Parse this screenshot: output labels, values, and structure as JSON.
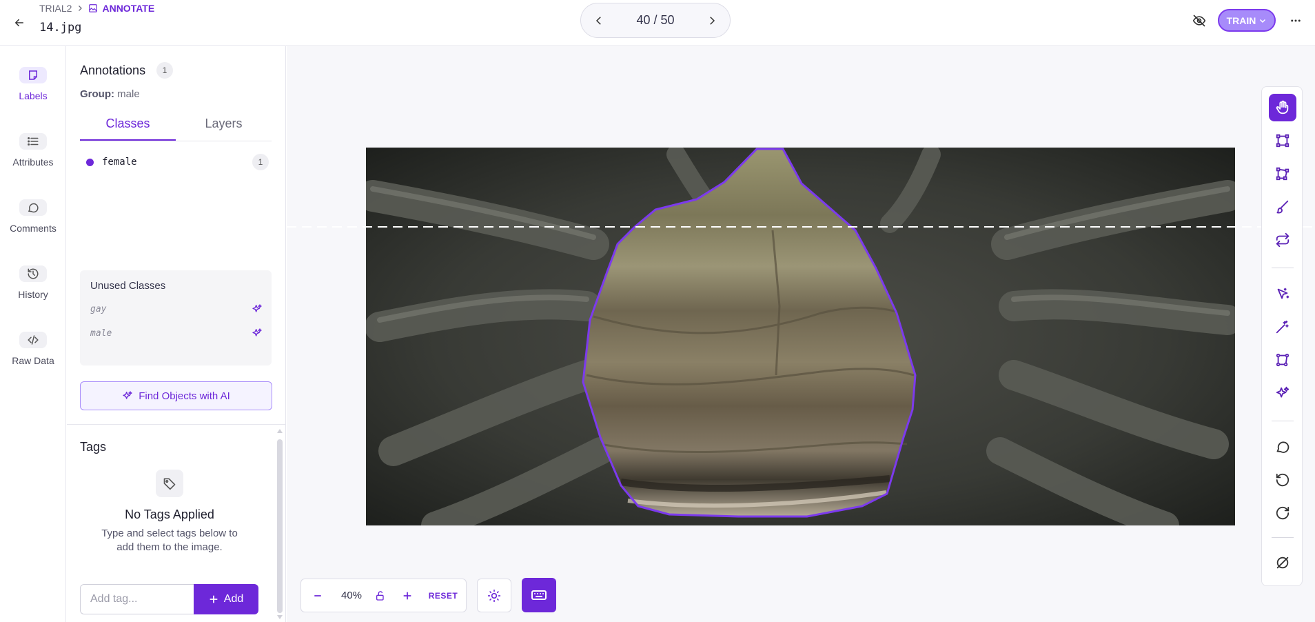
{
  "header": {
    "project": "TRIAL2",
    "mode": "ANNOTATE",
    "filename": "14.jpg",
    "pager": "40 / 50",
    "train_label": "TRAIN"
  },
  "leftnav": {
    "items": [
      {
        "label": "Labels",
        "icon": "label-icon"
      },
      {
        "label": "Attributes",
        "icon": "list-icon"
      },
      {
        "label": "Comments",
        "icon": "comment-icon"
      },
      {
        "label": "History",
        "icon": "history-icon"
      },
      {
        "label": "Raw Data",
        "icon": "code-icon"
      }
    ]
  },
  "panel": {
    "annotations_title": "Annotations",
    "annotations_count": "1",
    "group_label": "Group:",
    "group_value": "male",
    "tabs": [
      {
        "label": "Classes"
      },
      {
        "label": "Layers"
      }
    ],
    "classes": [
      {
        "name": "female",
        "count": "1",
        "color": "#6d28d9"
      }
    ],
    "unused_title": "Unused Classes",
    "unused": [
      {
        "name": "gay"
      },
      {
        "name": "male"
      }
    ],
    "find_ai": "Find Objects with AI",
    "tags_title": "Tags",
    "no_tags": "No Tags Applied",
    "tags_hint": "Type and select tags below to add them to the image.",
    "tag_placeholder": "Add tag...",
    "add_label": "Add"
  },
  "zoom": {
    "value": "40%",
    "reset": "RESET"
  },
  "colors": {
    "accent": "#6d28d9",
    "accent_light": "#a78bfa"
  }
}
